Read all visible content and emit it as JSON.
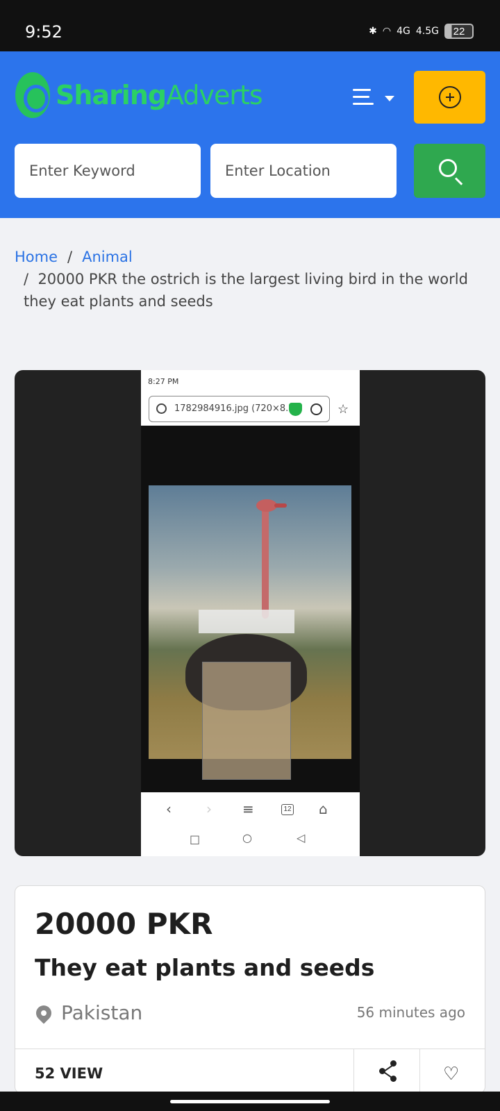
{
  "status_bar": {
    "time": "9:52",
    "network_1": "4G",
    "network_2": "4.5G",
    "battery": "22"
  },
  "header": {
    "logo_part1": "Sharing",
    "logo_part2": "Adverts",
    "keyword_placeholder": "Enter Keyword",
    "location_placeholder": "Enter Location"
  },
  "breadcrumb": {
    "home": "Home",
    "category": "Animal",
    "sep": "/",
    "current": "20000 PKR the ostrich is the largest living bird in the world they eat plants and seeds"
  },
  "gallery": {
    "inner_time": "8:27 PM",
    "inner_url": "1782984916.jpg (720×8...",
    "tab_count": "12"
  },
  "listing": {
    "price": "20000 PKR",
    "title": "They eat plants and seeds",
    "location": "Pakistan",
    "posted": "56 minutes ago",
    "views": "52 VIEW"
  },
  "colors": {
    "header_bg": "#2c74ec",
    "post_button": "#ffb800",
    "search_button": "#2fa84f",
    "logo": "#2bd065"
  }
}
